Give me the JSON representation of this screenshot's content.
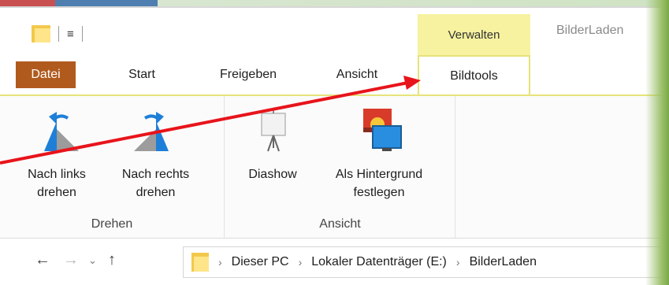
{
  "window": {
    "title": "BilderLaden"
  },
  "quick_access": {
    "dropdown_glyph": "≡"
  },
  "context_tab": {
    "label": "Verwalten"
  },
  "tabs": [
    {
      "label": "Datei"
    },
    {
      "label": "Start"
    },
    {
      "label": "Freigeben"
    },
    {
      "label": "Ansicht"
    },
    {
      "label": "Bildtools",
      "active": true
    }
  ],
  "ribbon": {
    "groups": [
      {
        "label": "Drehen",
        "commands": [
          {
            "line1": "Nach links",
            "line2": "drehen",
            "icon": "rotate-left-icon"
          },
          {
            "line1": "Nach rechts",
            "line2": "drehen",
            "icon": "rotate-right-icon"
          }
        ]
      },
      {
        "label": "Ansicht",
        "commands": [
          {
            "line1": "Diashow",
            "line2": "",
            "icon": "slideshow-icon"
          },
          {
            "line1": "Als Hintergrund",
            "line2": "festlegen",
            "icon": "set-background-icon"
          }
        ]
      }
    ]
  },
  "nav": {
    "back": "←",
    "forward": "→",
    "recent": "⌄",
    "up": "↑"
  },
  "breadcrumb": {
    "separator": "›",
    "items": [
      "Dieser PC",
      "Lokaler Datenträger (E:)",
      "BilderLaden"
    ]
  },
  "colors": {
    "file_tab": "#b05a1e",
    "context_tab": "#f6f2a0",
    "context_border": "#e6e27a",
    "annotation_arrow": "#e8141b"
  }
}
